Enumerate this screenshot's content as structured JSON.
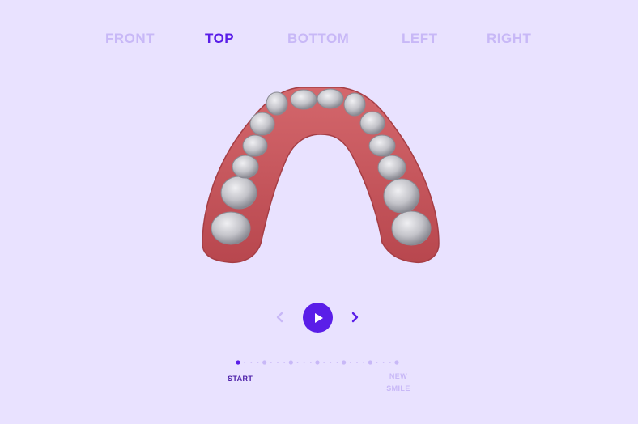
{
  "views": {
    "tabs": [
      {
        "label": "FRONT"
      },
      {
        "label": "TOP"
      },
      {
        "label": "BOTTOM"
      },
      {
        "label": "LEFT"
      },
      {
        "label": "RIGHT"
      }
    ],
    "active": "TOP"
  },
  "model": {
    "subject": "lower-dental-arch-3d-model"
  },
  "playback": {
    "prev_icon": "chevron-left-icon",
    "play_icon": "play-icon",
    "next_icon": "chevron-right-icon"
  },
  "timeline": {
    "start_label": "START",
    "end_label": "NEW\nSMILE",
    "steps": 7,
    "current_step": 1
  },
  "colors": {
    "background": "#e9e2ff",
    "accent": "#5a1ee8",
    "inactive": "#c8b8f7",
    "gum": "#c9575d",
    "tooth": "#c6c6cc"
  }
}
